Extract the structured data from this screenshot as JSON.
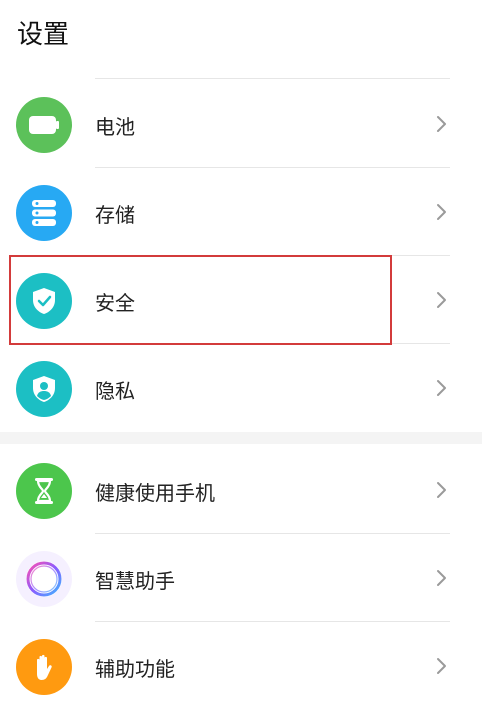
{
  "header": {
    "title": "设置"
  },
  "items": [
    {
      "label": "电池",
      "icon": "battery-icon",
      "color": "#5cc15a"
    },
    {
      "label": "存储",
      "icon": "storage-icon",
      "color": "#27a9f3"
    },
    {
      "label": "安全",
      "icon": "shield-check-icon",
      "color": "#1cbfc4"
    },
    {
      "label": "隐私",
      "icon": "privacy-shield-icon",
      "color": "#1cbfc4"
    },
    {
      "label": "健康使用手机",
      "icon": "hourglass-icon",
      "color": "#4cc64c"
    },
    {
      "label": "智慧助手",
      "icon": "assistant-ring-icon",
      "color": "#f5f0ff"
    },
    {
      "label": "辅助功能",
      "icon": "hand-icon",
      "color": "#ff9a10"
    }
  ]
}
